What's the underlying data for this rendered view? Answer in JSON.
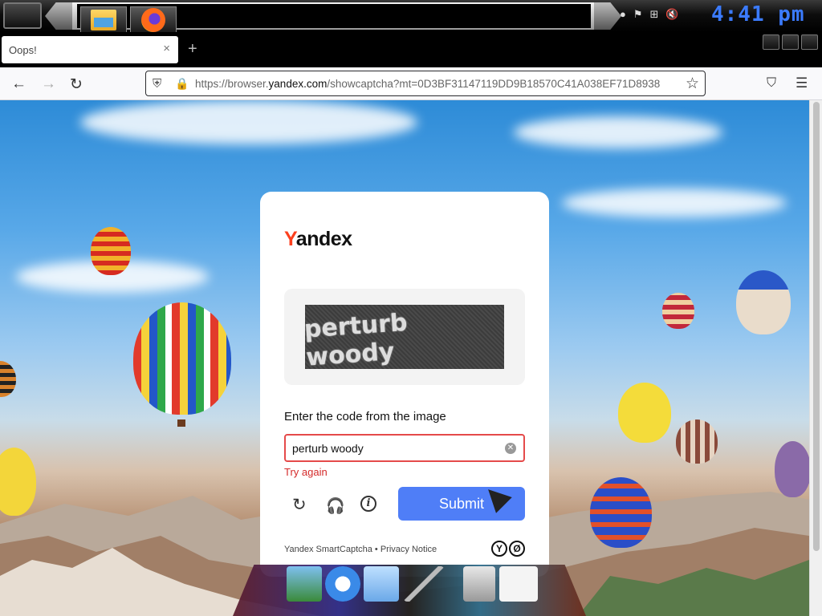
{
  "system_bar": {
    "clock": "4:41 pm",
    "taskbar_apps": [
      {
        "name": "File Explorer",
        "icon": "file-explorer-icon"
      },
      {
        "name": "Firefox",
        "icon": "firefox-icon"
      }
    ],
    "tray_icons": [
      "globe-icon",
      "flag-icon",
      "network-icon",
      "volume-muted-icon"
    ]
  },
  "browser": {
    "tab": {
      "title": "Oops!",
      "close": "×"
    },
    "new_tab": "+",
    "url_prefix": "https://browser.",
    "url_host": "yandex.com",
    "url_suffix": "/showcaptcha?mt=0D3BF31147119DD9B18570C41A038EF71D8938",
    "nav": {
      "back": "←",
      "forward": "→",
      "reload": "↻",
      "menu": "☰",
      "pocket": "⛉",
      "star": "☆",
      "shield": "⛨",
      "lock": "🔒"
    }
  },
  "captcha": {
    "logo_y": "Y",
    "logo_rest": "andex",
    "image_text": "perturb woody",
    "prompt": "Enter the code from the image",
    "input_value": "perturb woody",
    "error": "Try again",
    "submit_label": "Submit",
    "footer_brand": "Yandex SmartCaptcha",
    "footer_separator": " • ",
    "footer_link": "Privacy Notice",
    "badge_1": "Y",
    "badge_2": "Ø",
    "tools": {
      "reload": "↻",
      "audio": "🎧",
      "info": "i"
    }
  },
  "colors": {
    "accent": "#4f7ef7",
    "error": "#e54a4a",
    "logo_red": "#fc3f1d",
    "clock_blue": "#3b7bff"
  }
}
